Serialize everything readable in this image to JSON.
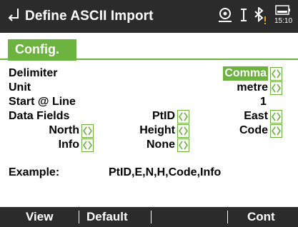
{
  "titlebar": {
    "title": "Define ASCII Import",
    "time": "15:10"
  },
  "tab": {
    "label": "Config."
  },
  "fields": {
    "delimiter": {
      "label": "Delimiter",
      "value": "Comma"
    },
    "unit": {
      "label": "Unit",
      "value": "metre"
    },
    "start_line": {
      "label": "Start @ Line",
      "value": "1"
    },
    "data_fields": {
      "label": "Data Fields",
      "field1": "PtID",
      "field2": "East",
      "field3": "North",
      "field4": "Height",
      "field5": "Code",
      "field6": "Info",
      "field7": "None"
    }
  },
  "example": {
    "label": "Example:",
    "value": "PtID,E,N,H,Code,Info"
  },
  "softkeys": {
    "f1": "View",
    "f2": "Default",
    "f3": "",
    "f4": "Cont"
  },
  "colors": {
    "accent": "#6db33f",
    "titlebar": "#2b2b2b"
  }
}
